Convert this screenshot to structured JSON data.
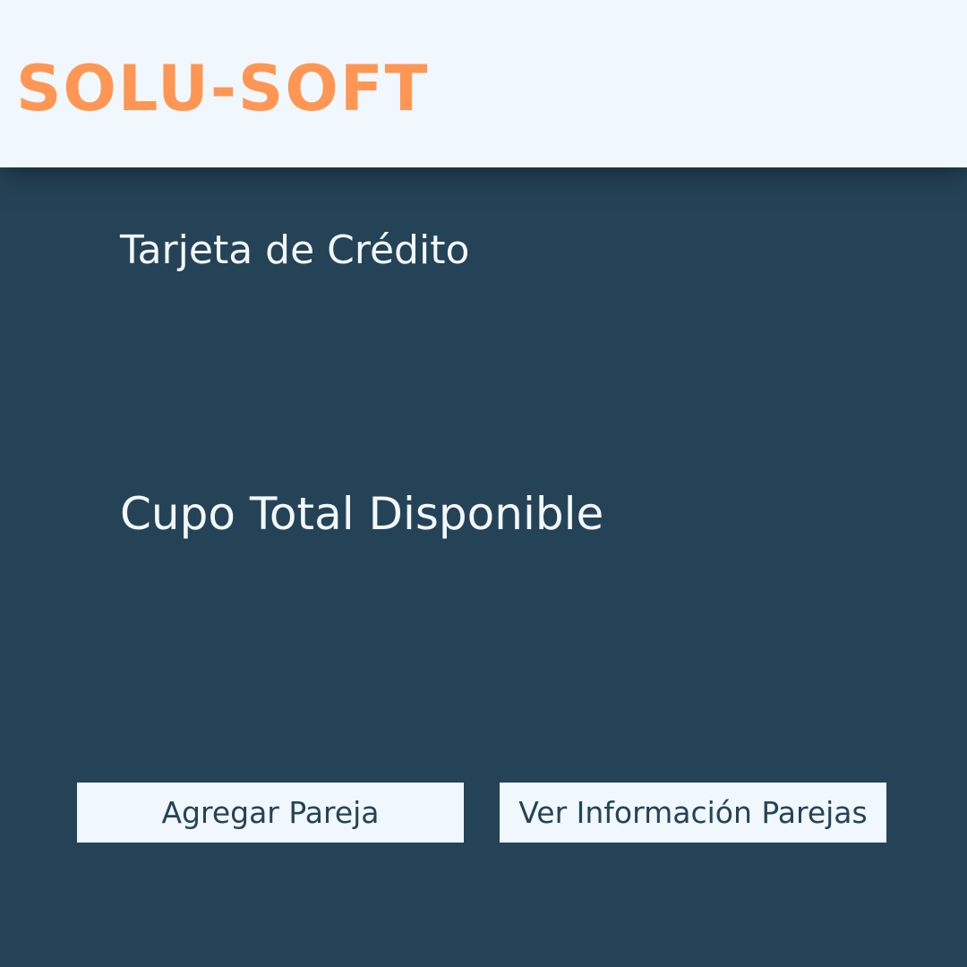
{
  "header": {
    "brand": "SOLU-SOFT"
  },
  "main": {
    "card_label": "Tarjeta de Crédito",
    "available_credit_label": "Cupo Total Disponible"
  },
  "actions": {
    "add_partner_label": "Agregar Pareja",
    "view_partners_label": "Ver Información Parejas"
  },
  "colors": {
    "header_background": "#f0f7fd",
    "brand": "#ff9653",
    "page_background": "#254357",
    "text_light": "#f3f7fa",
    "button_background": "#f0f7fd",
    "button_text": "#254357"
  }
}
